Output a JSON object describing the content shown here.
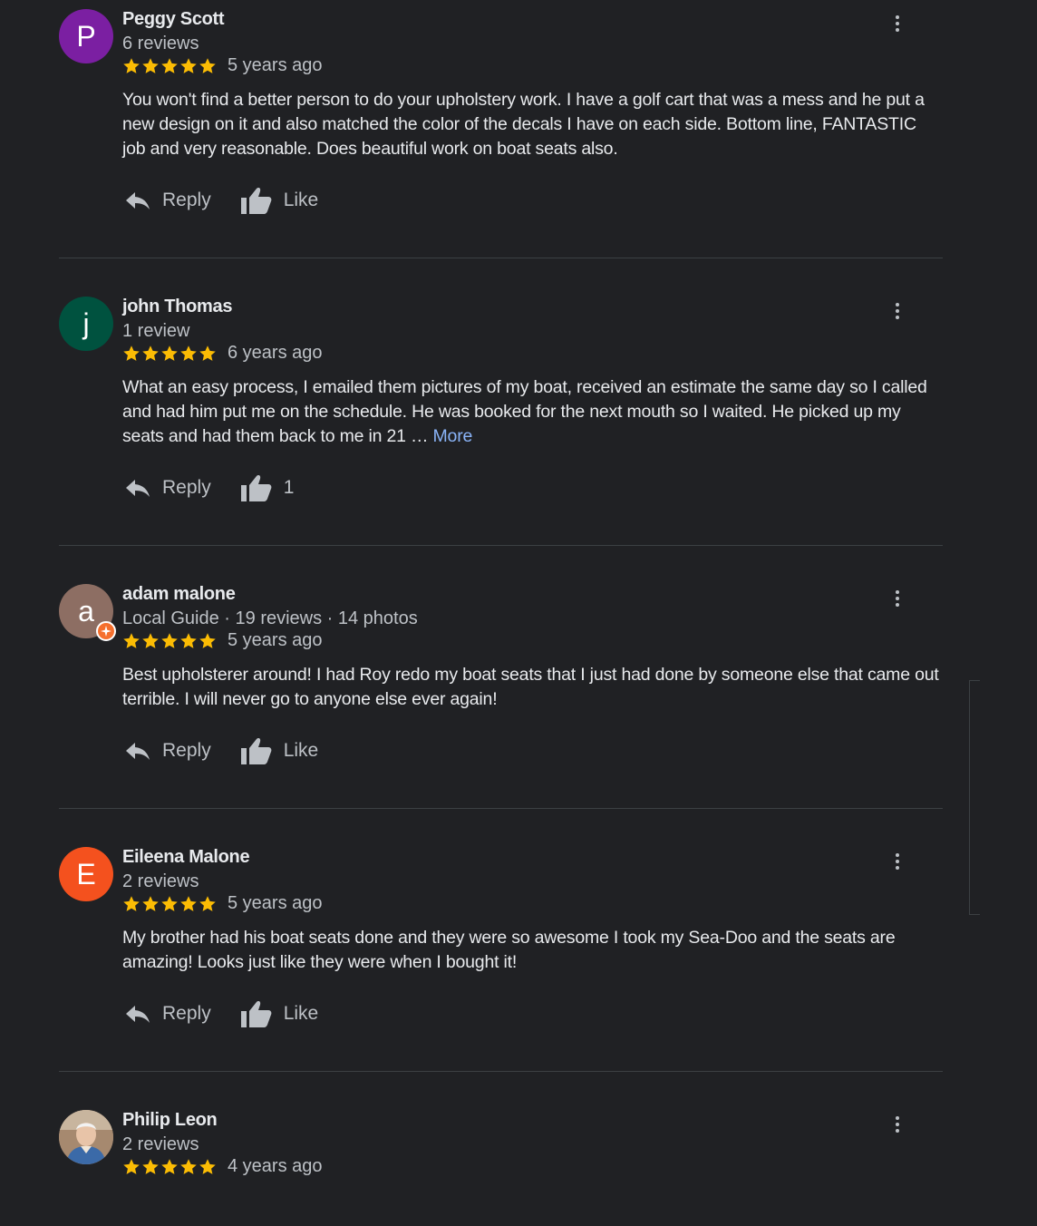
{
  "colors": {
    "background": "#202124",
    "star": "#fbbc04",
    "link": "#8ab4f8",
    "local_guide_badge": "#f56f2d"
  },
  "reviews": [
    {
      "initial": "P",
      "avatar_color": "#7b1fa2",
      "name": "Peggy Scott",
      "meta": "6 reviews",
      "stars": 5,
      "time": "5 years ago",
      "text": "You won't find a better person to do your upholstery work. I have a golf cart that was a mess and he put a new design on it and also matched the color of the decals I have on each side.  Bottom line, FANTASTIC job and very reasonable. Does beautiful work on boat seats also.",
      "more": "",
      "reply_label": "Reply",
      "like_label": "Like"
    },
    {
      "initial": "j",
      "avatar_color": "#00523f",
      "name": "john Thomas",
      "meta": "1 review",
      "stars": 5,
      "time": "6 years ago",
      "text": "What an easy process, I emailed them pictures of my boat, received an estimate the same day so I called and had him put me on the schedule. He was booked for the next mouth so I waited. He picked up my seats and had them back to me in 21 … ",
      "more": "More",
      "reply_label": "Reply",
      "like_label": "1"
    },
    {
      "initial": "a",
      "avatar_color": "#8d6e63",
      "name": "adam malone",
      "meta": "Local Guide · 19 reviews · 14 photos",
      "local_guide": true,
      "stars": 5,
      "time": "5 years ago",
      "text": "Best upholsterer around! I had Roy redo my boat seats that I just had done by someone else that came out terrible. I will never go to anyone else ever again!",
      "more": "",
      "reply_label": "Reply",
      "like_label": "Like"
    },
    {
      "initial": "E",
      "avatar_color": "#f4511e",
      "name": "Eileena Malone",
      "meta": "2 reviews",
      "stars": 5,
      "time": "5 years ago",
      "text": "My brother had his boat seats done and they were so awesome I took my Sea-Doo and the seats are amazing! Looks just like they were when I bought it!",
      "more": "",
      "reply_label": "Reply",
      "like_label": "Like"
    },
    {
      "initial": "",
      "avatar_color": "#9e8a78",
      "name": "Philip Leon",
      "meta": "2 reviews",
      "stars": 5,
      "time": "4 years ago",
      "text": "",
      "more": ""
    }
  ]
}
